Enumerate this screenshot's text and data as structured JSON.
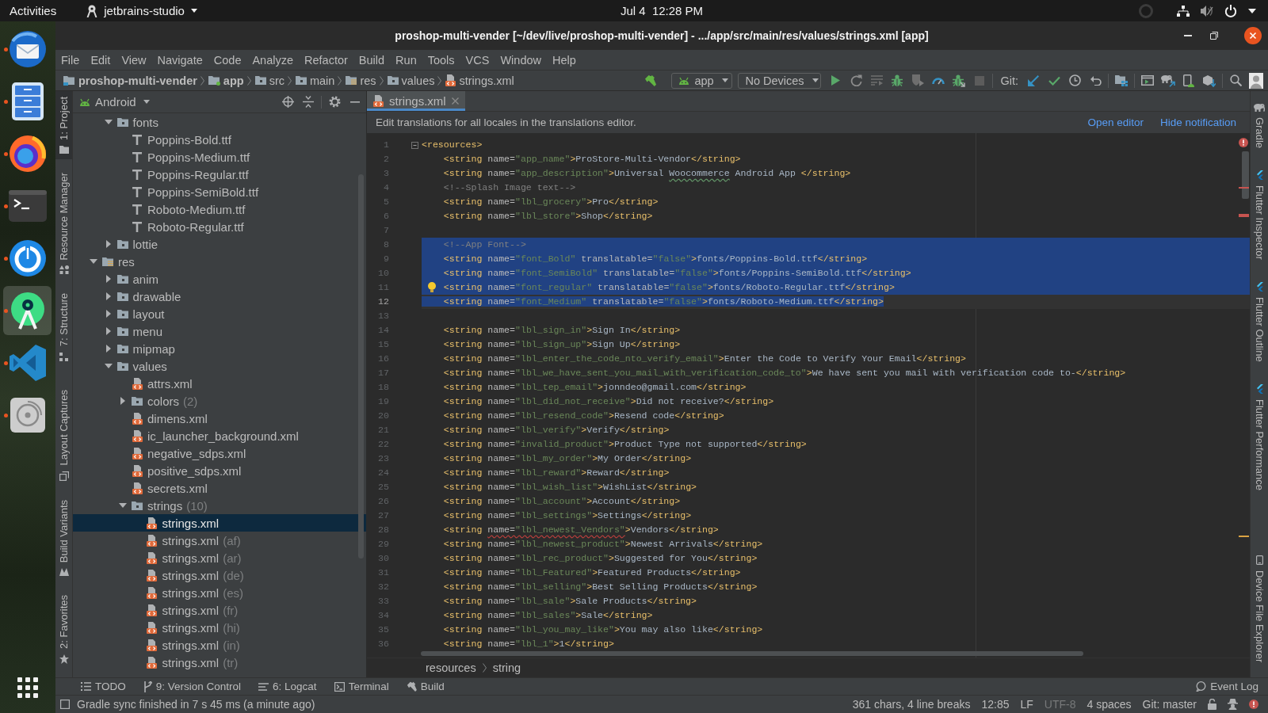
{
  "top_bar": {
    "activities": "Activities",
    "app_menu": "jetbrains-studio",
    "clock": "Jul 4  12:28 PM"
  },
  "dock": [
    {
      "kind": "mail",
      "running": true,
      "selected": false
    },
    {
      "kind": "files",
      "running": true,
      "selected": false
    },
    {
      "kind": "browser",
      "running": true,
      "selected": false
    },
    {
      "kind": "terminal",
      "running": true,
      "selected": false
    },
    {
      "kind": "dial",
      "running": true,
      "selected": false
    },
    {
      "kind": "studio",
      "running": true,
      "selected": true
    },
    {
      "kind": "editor",
      "running": true,
      "selected": false
    },
    {
      "kind": "disc",
      "running": true,
      "selected": false
    }
  ],
  "window": {
    "title": "proshop-multi-vender [~/dev/live/proshop-multi-vender] - .../app/src/main/res/values/strings.xml [app]"
  },
  "menu": [
    "File",
    "Edit",
    "View",
    "Navigate",
    "Code",
    "Analyze",
    "Refactor",
    "Build",
    "Run",
    "Tools",
    "VCS",
    "Window",
    "Help"
  ],
  "breadcrumbs": [
    {
      "label": "proshop-multi-vender",
      "kind": "project"
    },
    {
      "label": "app",
      "kind": "module"
    },
    {
      "label": "src",
      "kind": "folder"
    },
    {
      "label": "main",
      "kind": "folder"
    },
    {
      "label": "res",
      "kind": "resources"
    },
    {
      "label": "values",
      "kind": "folder"
    },
    {
      "label": "strings.xml",
      "kind": "xml"
    }
  ],
  "toolbar": [
    {
      "kind": "make",
      "disabled": false
    },
    {
      "kind": "config",
      "label": "app"
    },
    {
      "kind": "device",
      "label": "No Devices"
    },
    {
      "kind": "run",
      "disabled": false
    },
    {
      "kind": "rerun",
      "disabled": true
    },
    {
      "kind": "applycode",
      "disabled": true
    },
    {
      "kind": "debug",
      "disabled": false
    },
    {
      "kind": "profile",
      "disabled": true
    },
    {
      "kind": "profiler",
      "disabled": false
    },
    {
      "kind": "attach",
      "disabled": false
    },
    {
      "kind": "stop",
      "disabled": true
    },
    {
      "kind": "separator"
    },
    {
      "kind": "label",
      "label": "Git:"
    },
    {
      "kind": "update",
      "disabled": false
    },
    {
      "kind": "commit",
      "disabled": false
    },
    {
      "kind": "history",
      "disabled": false
    },
    {
      "kind": "rollback",
      "disabled": false
    },
    {
      "kind": "separator"
    },
    {
      "kind": "structure",
      "disabled": false
    },
    {
      "kind": "separator"
    },
    {
      "kind": "runwindow",
      "disabled": false
    },
    {
      "kind": "sync",
      "disabled": false
    },
    {
      "kind": "avd",
      "disabled": false
    },
    {
      "kind": "sdk",
      "disabled": false
    },
    {
      "kind": "separator"
    },
    {
      "kind": "search",
      "disabled": false
    },
    {
      "kind": "account",
      "disabled": false
    }
  ],
  "project_panel": {
    "view": "Android",
    "tree": [
      {
        "children": [
          {
            "label": "fonts",
            "kind": "folder",
            "expanded": true,
            "selected": false,
            "children": [
              {
                "label": "Poppins-Bold.ttf",
                "kind": "font",
                "selected": false
              },
              {
                "label": "Poppins-Medium.ttf",
                "kind": "font",
                "selected": false
              },
              {
                "label": "Poppins-Regular.ttf",
                "kind": "font",
                "selected": false
              },
              {
                "label": "Poppins-SemiBold.ttf",
                "kind": "font",
                "selected": false
              },
              {
                "label": "Roboto-Medium.ttf",
                "kind": "font",
                "selected": false
              },
              {
                "label": "Roboto-Regular.ttf",
                "kind": "font",
                "selected": false
              }
            ]
          },
          {
            "label": "lottie",
            "kind": "folder",
            "expanded": false,
            "selected": false
          }
        ]
      },
      {
        "label": "res",
        "kind": "resources",
        "expanded": true,
        "selected": false,
        "children": [
          {
            "label": "anim",
            "kind": "folder",
            "expanded": false,
            "selected": false
          },
          {
            "label": "drawable",
            "kind": "folder",
            "expanded": false,
            "selected": false
          },
          {
            "label": "layout",
            "kind": "folder",
            "expanded": false,
            "selected": false
          },
          {
            "label": "menu",
            "kind": "folder",
            "expanded": false,
            "selected": false
          },
          {
            "label": "mipmap",
            "kind": "folder",
            "expanded": false,
            "selected": false
          },
          {
            "label": "values",
            "kind": "folder",
            "expanded": true,
            "selected": false,
            "children": [
              {
                "label": "attrs.xml",
                "kind": "xml",
                "selected": false
              },
              {
                "label": "colors",
                "note": "(2)",
                "kind": "folder",
                "expanded": false,
                "selected": false
              },
              {
                "label": "dimens.xml",
                "kind": "xml",
                "selected": false
              },
              {
                "label": "ic_launcher_background.xml",
                "kind": "xml",
                "selected": false
              },
              {
                "label": "negative_sdps.xml",
                "kind": "xml",
                "selected": false
              },
              {
                "label": "positive_sdps.xml",
                "kind": "xml",
                "selected": false
              },
              {
                "label": "secrets.xml",
                "kind": "xml",
                "selected": false
              },
              {
                "label": "strings",
                "note": "(10)",
                "kind": "folder",
                "expanded": true,
                "selected": false,
                "children": [
                  {
                    "label": "strings.xml",
                    "kind": "xml",
                    "selected": true
                  },
                  {
                    "label": "strings.xml",
                    "note": "(af)",
                    "kind": "xml",
                    "selected": false
                  },
                  {
                    "label": "strings.xml",
                    "note": "(ar)",
                    "kind": "xml",
                    "selected": false
                  },
                  {
                    "label": "strings.xml",
                    "note": "(de)",
                    "kind": "xml",
                    "selected": false
                  },
                  {
                    "label": "strings.xml",
                    "note": "(es)",
                    "kind": "xml",
                    "selected": false
                  },
                  {
                    "label": "strings.xml",
                    "note": "(fr)",
                    "kind": "xml",
                    "selected": false
                  },
                  {
                    "label": "strings.xml",
                    "note": "(hi)",
                    "kind": "xml",
                    "selected": false
                  },
                  {
                    "label": "strings.xml",
                    "note": "(in)",
                    "kind": "xml",
                    "selected": false
                  },
                  {
                    "label": "strings.xml",
                    "note": "(tr)",
                    "kind": "xml",
                    "selected": false
                  }
                ]
              }
            ]
          }
        ]
      }
    ]
  },
  "left_tool_strip": {
    "top": [
      {
        "label": "1: Project",
        "kind": "project",
        "selected": true
      },
      {
        "label": "Resource Manager",
        "kind": "resources",
        "selected": false
      },
      {
        "label": "7: Structure",
        "kind": "structure",
        "selected": false
      }
    ],
    "bottom": [
      {
        "label": "Layout Captures",
        "kind": "captures",
        "selected": false
      },
      {
        "label": "Build Variants",
        "kind": "variants",
        "selected": false
      },
      {
        "label": "2: Favorites",
        "kind": "favorites",
        "selected": false
      }
    ]
  },
  "editor": {
    "tabs": [
      {
        "label": "strings.xml",
        "selected": true
      }
    ],
    "notification": {
      "text": "Edit translations for all locales in the translations editor.",
      "links": [
        "Open editor",
        "Hide notification"
      ]
    },
    "lines": [
      {
        "number": "1",
        "text": "<resources>",
        "fold": true,
        "selected": false,
        "current": false,
        "children": [
          {
            "number": "2",
            "text": "<string name=\"app_name\">ProStore-Multi-Vendor</string>",
            "selected": false,
            "current": false
          },
          {
            "number": "3",
            "segments": [
              {
                "text": "<string name=\"app_description\">Universal ",
                "kind": "plain"
              },
              {
                "text": "Woocommerce",
                "kind": "typo"
              },
              {
                "text": " Android App </string>",
                "kind": "plain"
              }
            ],
            "selected": false,
            "current": false
          },
          {
            "number": "4",
            "text": "<!--Splash Image text-->",
            "selected": false,
            "current": false
          },
          {
            "number": "5",
            "text": "<string name=\"lbl_grocery\">Pro</string>",
            "selected": false,
            "current": false
          },
          {
            "number": "6",
            "text": "<string name=\"lbl_store\">Shop</string>",
            "selected": false,
            "current": false
          },
          {
            "number": "7"
          },
          {
            "number": "8",
            "text": "<!--App Font-->",
            "selected": true,
            "current": false
          },
          {
            "number": "9",
            "text": "<string name=\"font_Bold\" translatable=\"false\">fonts/Poppins-Bold.ttf</string>",
            "selected": true,
            "current": false
          },
          {
            "number": "10",
            "text": "<string name=\"font_SemiBold\" translatable=\"false\">fonts/Poppins-SemiBold.ttf</string>",
            "selected": true,
            "current": false
          },
          {
            "number": "11",
            "text": "<string name=\"font_regular\" translatable=\"false\">fonts/Roboto-Regular.ttf</string>",
            "selected": true,
            "current": false,
            "bulb": true
          },
          {
            "number": "12",
            "text": "<string name=\"font_Medium\" translatable=\"false\">fonts/Roboto-Medium.ttf</string>",
            "selected": true,
            "current": true
          },
          {
            "number": "13"
          },
          {
            "number": "14",
            "text": "<string name=\"lbl_sign_in\">Sign In</string>",
            "selected": false,
            "current": false
          },
          {
            "number": "15",
            "text": "<string name=\"lbl_sign_up\">Sign Up</string>",
            "selected": false,
            "current": false
          },
          {
            "number": "16",
            "text": "<string name=\"lbl_enter_the_code_nto_verify_email\">Enter the Code to Verify Your Email</string>",
            "selected": false,
            "current": false
          },
          {
            "number": "17",
            "text": "<string name=\"lbl_we_have_sent_you_mail_with_verification_code_to\">We have sent you mail with verification code to-</string>",
            "selected": false,
            "current": false
          },
          {
            "number": "18",
            "text": "<string name=\"lbl_tep_email\">jonndeo@gmail.com</string>",
            "selected": false,
            "current": false
          },
          {
            "number": "19",
            "text": "<string name=\"lbl_did_not_receive\">Did not receive?</string>",
            "selected": false,
            "current": false
          },
          {
            "number": "20",
            "text": "<string name=\"lbl_resend_code\">Resend code</string>",
            "selected": false,
            "current": false
          },
          {
            "number": "21",
            "text": "<string name=\"lbl_verify\">Verify</string>",
            "selected": false,
            "current": false
          },
          {
            "number": "22",
            "text": "<string name=\"invalid_product\">Product Type not supported</string>",
            "selected": false,
            "current": false
          },
          {
            "number": "23",
            "text": "<string name=\"lbl_my_order\">My Order</string>",
            "selected": false,
            "current": false
          },
          {
            "number": "24",
            "text": "<string name=\"lbl_reward\">Reward</string>",
            "selected": false,
            "current": false
          },
          {
            "number": "25",
            "text": "<string name=\"lbl_wish_list\">WishList</string>",
            "selected": false,
            "current": false
          },
          {
            "number": "26",
            "text": "<string name=\"lbl_account\">Account</string>",
            "selected": false,
            "current": false
          },
          {
            "number": "27",
            "text": "<string name=\"lbl_settings\">Settings</string>",
            "selected": false,
            "current": false
          },
          {
            "number": "28",
            "segments": [
              {
                "text": "<string ",
                "kind": "plain"
              },
              {
                "text": "name=\"lbl_newest_Vendors\"",
                "kind": "error"
              },
              {
                "text": ">Vendors</string>",
                "kind": "plain"
              }
            ],
            "selected": false,
            "current": false
          },
          {
            "number": "29",
            "text": "<string name=\"lbl_newest_product\">Newest Arrivals</string>",
            "selected": false,
            "current": false
          },
          {
            "number": "30",
            "text": "<string name=\"lbl_rec_product\">Suggested for You</string>",
            "selected": false,
            "current": false
          },
          {
            "number": "31",
            "text": "<string name=\"lbl_Featured\">Featured Products</string>",
            "selected": false,
            "current": false
          },
          {
            "number": "32",
            "text": "<string name=\"lbl_selling\">Best Selling Products</string>",
            "selected": false,
            "current": false
          },
          {
            "number": "33",
            "text": "<string name=\"lbl_sale\">Sale Products</string>",
            "selected": false,
            "current": false
          },
          {
            "number": "34",
            "text": "<string name=\"lbl_sales\">Sale</string>",
            "selected": false,
            "current": false
          },
          {
            "number": "35",
            "text": "<string name=\"lbl_you_may_like\">You may also like</string>",
            "selected": false,
            "current": false
          },
          {
            "number": "36",
            "text": "<string name=\"lbl_1\">1</string>",
            "selected": false,
            "current": false
          }
        ]
      }
    ],
    "breadcrumbs": [
      "resources",
      "string"
    ]
  },
  "right_tool_strip": {
    "top": [
      {
        "label": "Gradle",
        "kind": "gradle",
        "selected": false
      },
      {
        "label": "Flutter Inspector",
        "kind": "flutter",
        "selected": false
      },
      {
        "label": "Flutter Outline",
        "kind": "flutter",
        "selected": false
      },
      {
        "label": "Flutter Performance",
        "kind": "flutter",
        "selected": false
      }
    ],
    "bottom": [
      {
        "label": "Device File Explorer",
        "kind": "device",
        "selected": false
      }
    ]
  },
  "tool_windows": [
    {
      "label": "TODO",
      "kind": "todo"
    },
    {
      "label": "9: Version Control",
      "kind": "vcs"
    },
    {
      "label": "6: Logcat",
      "kind": "logcat"
    },
    {
      "label": "Terminal",
      "kind": "terminal"
    },
    {
      "label": "Build",
      "kind": "build"
    }
  ],
  "event_log": "Event Log",
  "status_bar": {
    "message": "Gradle sync finished in 7 s 45 ms (a minute ago)",
    "items": [
      {
        "text": "361 chars, 4 line breaks",
        "disabled": false
      },
      {
        "text": "12:85",
        "disabled": false
      },
      {
        "text": "LF",
        "disabled": false
      },
      {
        "text": "UTF-8",
        "disabled": true
      },
      {
        "text": "4 spaces",
        "disabled": false
      },
      {
        "text": "Git: master",
        "disabled": false
      }
    ]
  }
}
